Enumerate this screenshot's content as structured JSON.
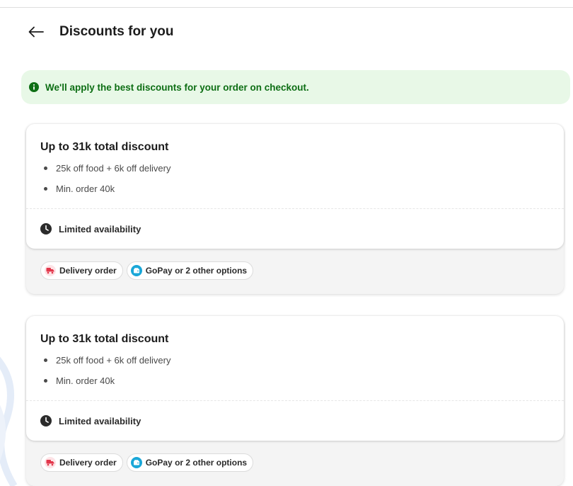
{
  "header": {
    "title": "Discounts for you",
    "back_icon": "arrow-left-icon"
  },
  "banner": {
    "text": "We'll apply the best discounts for your order on checkout.",
    "icon": "info-icon",
    "text_color": "#0d6e14",
    "bg_color": "#e8f8e7"
  },
  "cards": [
    {
      "title": "Up to 31k total discount",
      "bullets": [
        "25k off food + 6k off delivery",
        "Min. order 40k"
      ],
      "availability": "Limited availability",
      "chips": [
        {
          "label": "Delivery order",
          "icon": "delivery-icon"
        },
        {
          "label": "GoPay or 2 other options",
          "icon": "wallet-icon"
        }
      ]
    },
    {
      "title": "Up to 31k total discount",
      "bullets": [
        "25k off food + 6k off delivery",
        "Min. order 40k"
      ],
      "availability": "Limited availability",
      "chips": [
        {
          "label": "Delivery order",
          "icon": "delivery-icon"
        },
        {
          "label": "GoPay or 2 other options",
          "icon": "wallet-icon"
        }
      ]
    }
  ]
}
